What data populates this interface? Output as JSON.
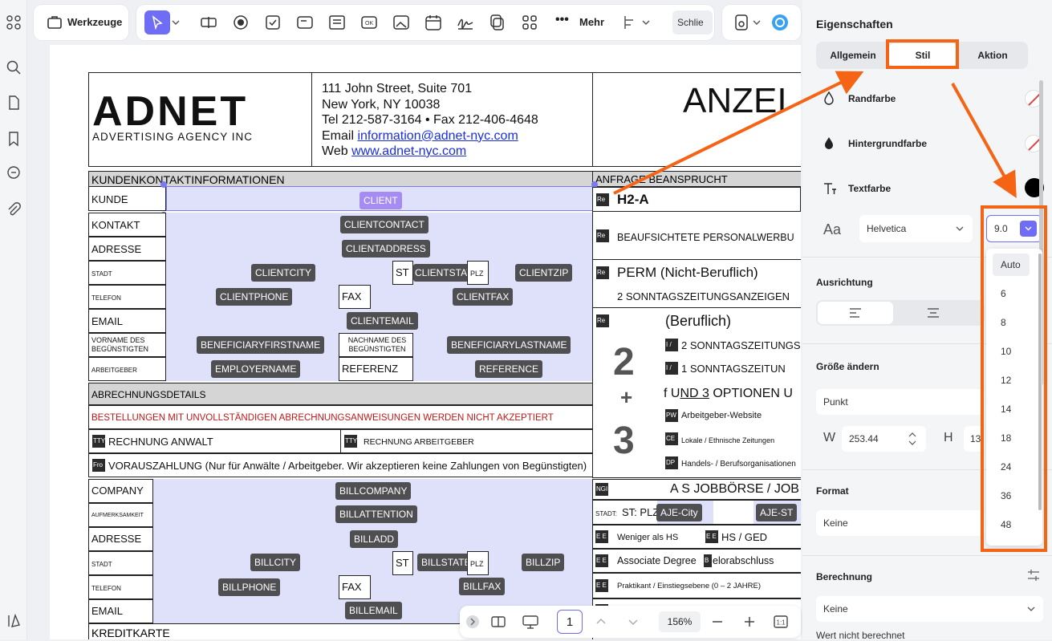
{
  "toolbar": {
    "tools_label": "Werkzeuge",
    "more_label": "Mehr",
    "close_label": "Schlie"
  },
  "document": {
    "company_address": [
      "111 John Street, Suite 701",
      "New York, NY 10038",
      "Tel 212-587-3164 • Fax 212-406-4648"
    ],
    "email_prefix": "Email ",
    "email_link": "information@adnet-nyc.com",
    "web_prefix": "Web ",
    "web_link": "www.adnet-nyc.com",
    "logo_text": "ADNET",
    "logo_sub": "ADVERTISING AGENCY INC",
    "big_title": "ANZEI",
    "client_section": "KUNDENKONTAKTINFORMATIONEN",
    "request_section": "ANFRAGE BEANSPRUCHT",
    "rows": {
      "kunde": "KUNDE",
      "kontakt": "KONTAKT",
      "adresse": "ADRESSE",
      "stadt": "STADT",
      "st": "ST",
      "plz": "PLZ",
      "telefon": "TELEFON",
      "fax": "FAX",
      "email": "EMAIL",
      "vorname": "VORNAME  DES BEGÜNSTIGTEN",
      "nachname": "NACHNAME DES BEGÜNSTIGTEN",
      "arbeitgeber": "ARBEITGEBER",
      "referenz": "REFERENZ"
    },
    "chips": {
      "client": "CLIENT",
      "clientcontact": "CLIENTCONTACT",
      "clientaddress": "CLIENTADDRESS",
      "clientcity": "CLIENTCITY",
      "clientstate": "CLIENTSTATE",
      "clientzip": "CLIENTZIP",
      "clientphone": "CLIENTPHONE",
      "clientfax": "CLIENTFAX",
      "clientemail": "CLIENTEMAIL",
      "beneficiaryfirstname": "BENEFICIARYFIRSTNAME",
      "beneficiarylastname": "BENEFICIARYLASTNAME",
      "employername": "EMPLOYERNAME",
      "reference": "REFERENCE",
      "billcompany": "BILLCOMPANY",
      "billattention": "BILLATTENTION",
      "billadd": "BILLADD",
      "billcity": "BILLCITY",
      "billstate": "BILLSTATE",
      "billzip": "BILLZIP",
      "billphone": "BILLPHONE",
      "billfax": "BILLFAX",
      "billemail": "BILLEMAIL",
      "ajecity": "AJE-City",
      "ajest": "AJE-ST"
    },
    "billing_section": "ABRECHNUNGSDETAILS",
    "billing_warning": "BESTELLUNGEN MIT UNVOLLSTÄNDIGEN ABRECHNUNGSANWEISUNGEN WERDEN NICHT AKZEPTIERT",
    "invoice_attorney": "RECHNUNG ANWALT",
    "invoice_employer": "RECHNUNG ARBEITGEBER",
    "prepay": "VORAUSZAHLUNG (Nur für Anwälte / Arbeitgeber. Wir akzeptieren keine Zahlungen von Begünstigten)",
    "company": "COMPANY",
    "attention": "AUFMERKSAMKEIT",
    "credit_card": "KREDITKARTE",
    "h2a": "H2-A",
    "supervised": "BEAUFSICHTETE PERSONALWERBU",
    "perm": "PERM (Nicht-Beruflich)",
    "sunday_ads": "2 SONNTAGSZEITUNGSANZEIGEN",
    "beruflich": "(Beruflich)",
    "sunday_ads2": "2 SONNTAGSZEITUNGS",
    "sunday_ads3": "1 SONNTAGSZEITUN",
    "big2": "2",
    "plus": "+",
    "big3": "3",
    "options_pre": "f U",
    "options_ul": "ND 3",
    "options_post": " OPTIONEN U",
    "employer_web": "Arbeitgeber-Website",
    "local_papers": "Lokale / Ethnische Zeitungen",
    "trade_orgs": "Handels- / Berufsorganisationen",
    "job_board": "A S JOBBÖRSE / JOB",
    "stadt_st_plz": "ST: PLZ",
    "stadt_small": "STADT:",
    "weniger_hs": "Weniger als HS",
    "hs_ged": "HS / GED",
    "associate": "Associate Degree",
    "bachelor": "elorabschluss",
    "praktikant": "Praktikant / Einstiegsebene (0 – 2 JAHRE)",
    "cb_re": "Re",
    "cb_pw": "PW",
    "cb_ce": "CE",
    "cb_dp": "DP",
    "cb_tt": "TTY",
    "cb_fro": "Fro",
    "cb_ee": "E E",
    "cb_ngi": "NGI",
    "cb_i": "I /",
    "cb_b": "B"
  },
  "bottombar": {
    "page": "1",
    "zoom": "156%"
  },
  "panel": {
    "title": "Eigenschaften",
    "tabs": [
      "Allgemein",
      "Stil",
      "Aktion"
    ],
    "border_color": "Randfarbe",
    "bg_color": "Hintergrundfarbe",
    "text_color": "Textfarbe",
    "font_name": "Helvetica",
    "font_size": "9.0",
    "alignment": "Ausrichtung",
    "resize": "Größe ändern",
    "unit": "Punkt",
    "w_label": "W",
    "w_value": "253.44",
    "h_label": "H",
    "h_value": "13",
    "format": "Format",
    "format_value": "Keine",
    "calculation": "Berechnung",
    "calc_value": "Keine",
    "not_calculated": "Wert nicht berechnet",
    "size_options": [
      "Auto",
      "6",
      "8",
      "10",
      "12",
      "14",
      "18",
      "24",
      "36",
      "48"
    ]
  },
  "colors": {
    "accent": "#6f6cf5",
    "highlight": "#f46414",
    "field_fill": "#dfe1fb"
  }
}
